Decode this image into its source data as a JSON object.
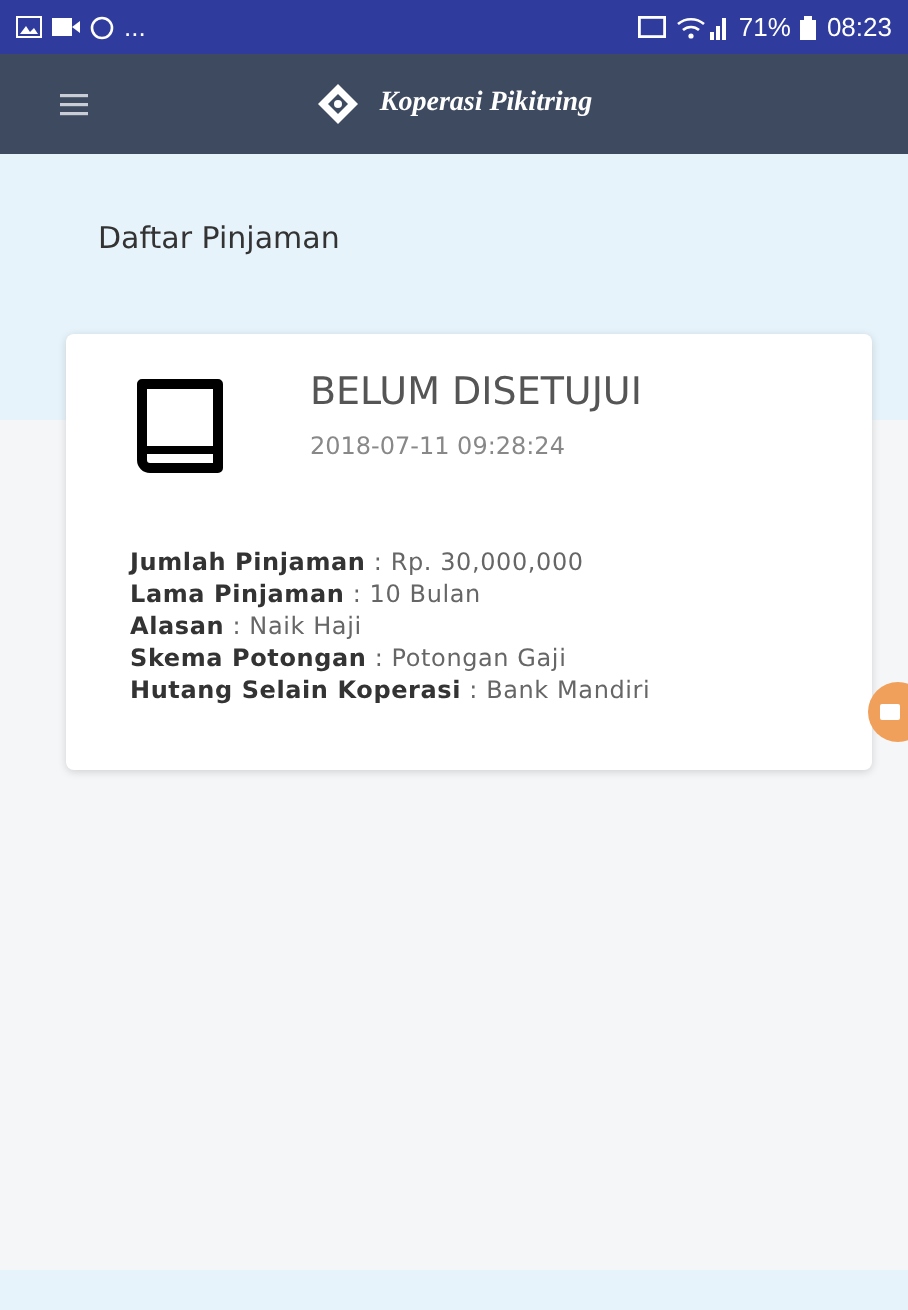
{
  "status_bar": {
    "overflow": "...",
    "battery": "71%",
    "time": "08:23"
  },
  "app_bar": {
    "title": "Koperasi Pikitring"
  },
  "page_title": "Daftar Pinjaman",
  "loans": [
    {
      "status": "BELUM DISETUJUI",
      "date": "2018-07-11 09:28:24",
      "details": [
        "**Jumlah Pinjaman** : Rp. 30,000,000",
        "**Lama Pinjaman** : 10 Bulan",
        "**Alasan** : Naik Haji",
        "**Skema Potongan** : Potongan Gaji",
        "**Hutang Selain Koperasi** : Bank Mandiri"
      ]
    }
  ]
}
